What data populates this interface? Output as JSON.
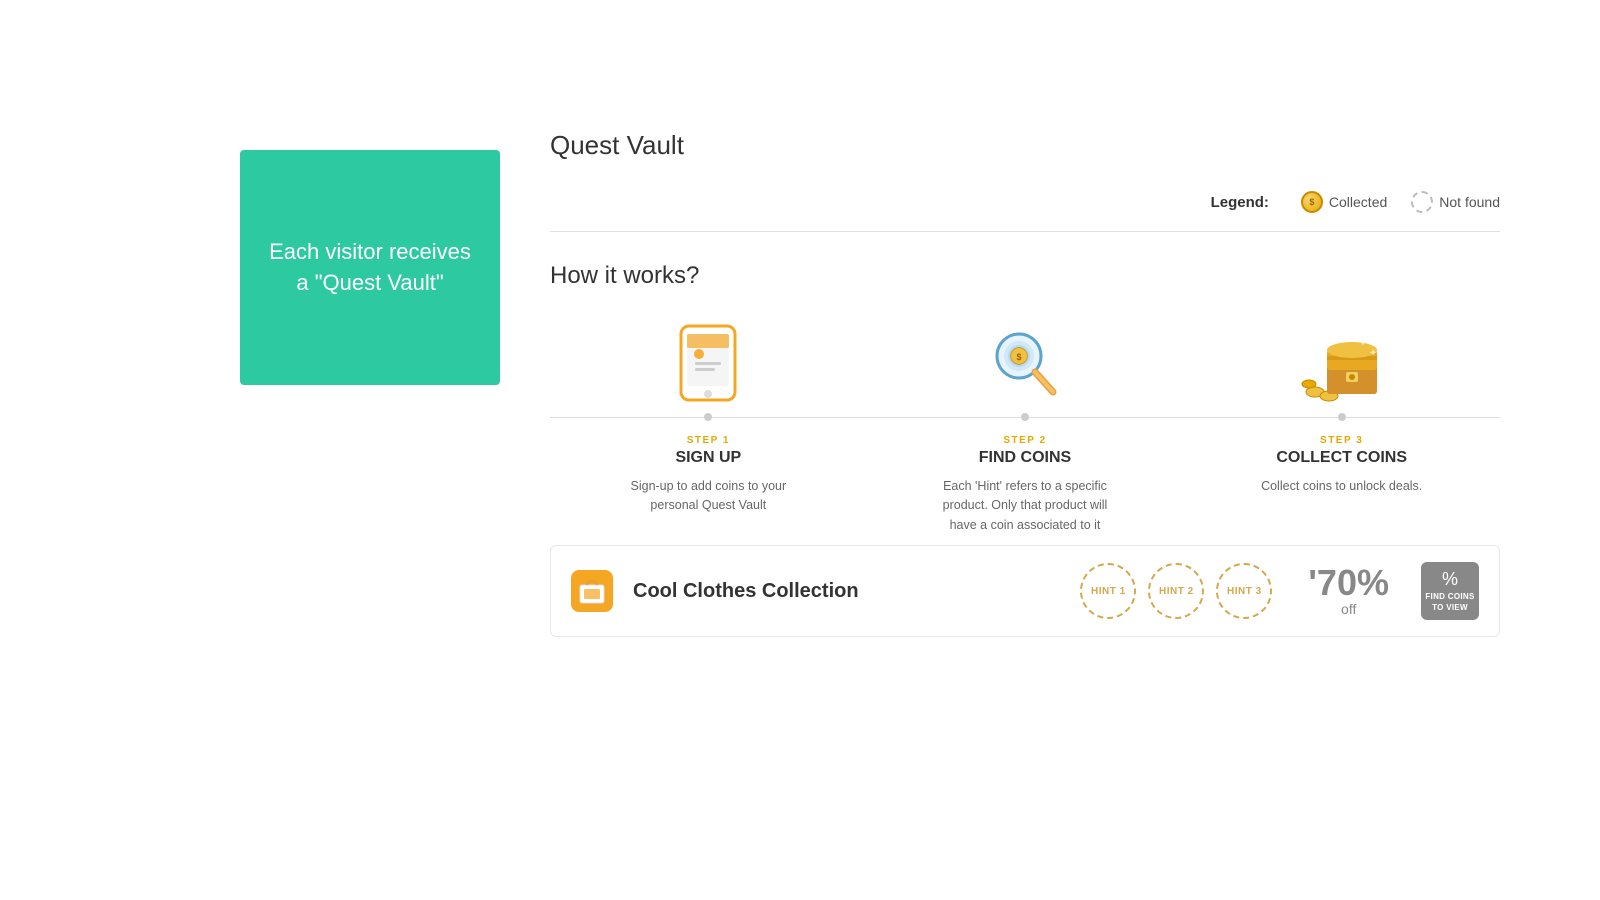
{
  "page": {
    "title": "Quest Vault"
  },
  "left_panel": {
    "text": "Each visitor receives a \"Quest Vault\""
  },
  "legend": {
    "label": "Legend:",
    "collected": "Collected",
    "not_found": "Not found"
  },
  "how_it_works": {
    "title": "How it works?",
    "steps": [
      {
        "number": "STEP 1",
        "title": "SIGN UP",
        "description": "Sign-up to add coins to your personal Quest Vault"
      },
      {
        "number": "STEP 2",
        "title": "FIND COINS",
        "description": "Each 'Hint' refers to a specific product. Only that product will have a coin associated to it"
      },
      {
        "number": "STEP 3",
        "title": "COLLECT COINS",
        "description": "Collect coins to unlock deals."
      }
    ]
  },
  "deal": {
    "name": "Cool Clothes Collection",
    "hints": [
      "HINT 1",
      "HINT 2",
      "HINT 3"
    ],
    "discount": "'70%",
    "off_label": "off",
    "find_coins_line1": "FIND COINS",
    "find_coins_line2": "TO VIEW"
  }
}
